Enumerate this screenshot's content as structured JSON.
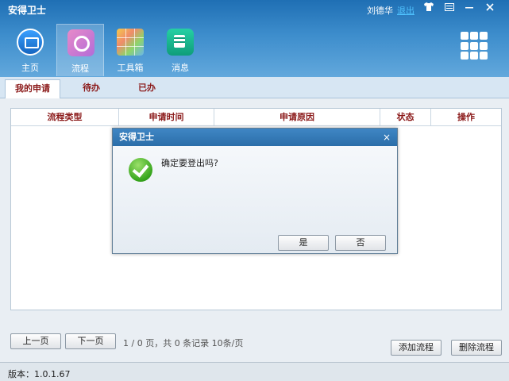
{
  "app": {
    "title": "安得卫士",
    "user_name": "刘德华",
    "logout_label": "退出",
    "window_buttons": [
      "shirt-icon",
      "menu-icon",
      "minimize-icon",
      "close-icon"
    ]
  },
  "nav": [
    {
      "label": "主页",
      "icon": "monitor-icon"
    },
    {
      "label": "流程",
      "icon": "flow-icon"
    },
    {
      "label": "工具箱",
      "icon": "cube-icon"
    },
    {
      "label": "消息",
      "icon": "message-icon"
    }
  ],
  "tabs": [
    {
      "label": "我的申请"
    },
    {
      "label": "待办"
    },
    {
      "label": "已办"
    }
  ],
  "table": {
    "columns": [
      "流程类型",
      "申请时间",
      "申请原因",
      "状态",
      "操作"
    ],
    "rows": []
  },
  "pager": {
    "prev_label": "上一页",
    "next_label": "下一页",
    "info": "1 / 0  页，共  0    条记录   10条/页"
  },
  "actions": {
    "add_label": "添加流程",
    "delete_label": "删除流程"
  },
  "status": {
    "version": "版本：1.0.1.67"
  },
  "dialog": {
    "title": "安得卫士",
    "close": "×",
    "message": "确定要登出吗?",
    "yes_label": "是",
    "no_label": "否"
  },
  "colors": {
    "header": "#2f7fc0",
    "tab_text": "#8b1a1a",
    "link": "#4fc3ff"
  }
}
